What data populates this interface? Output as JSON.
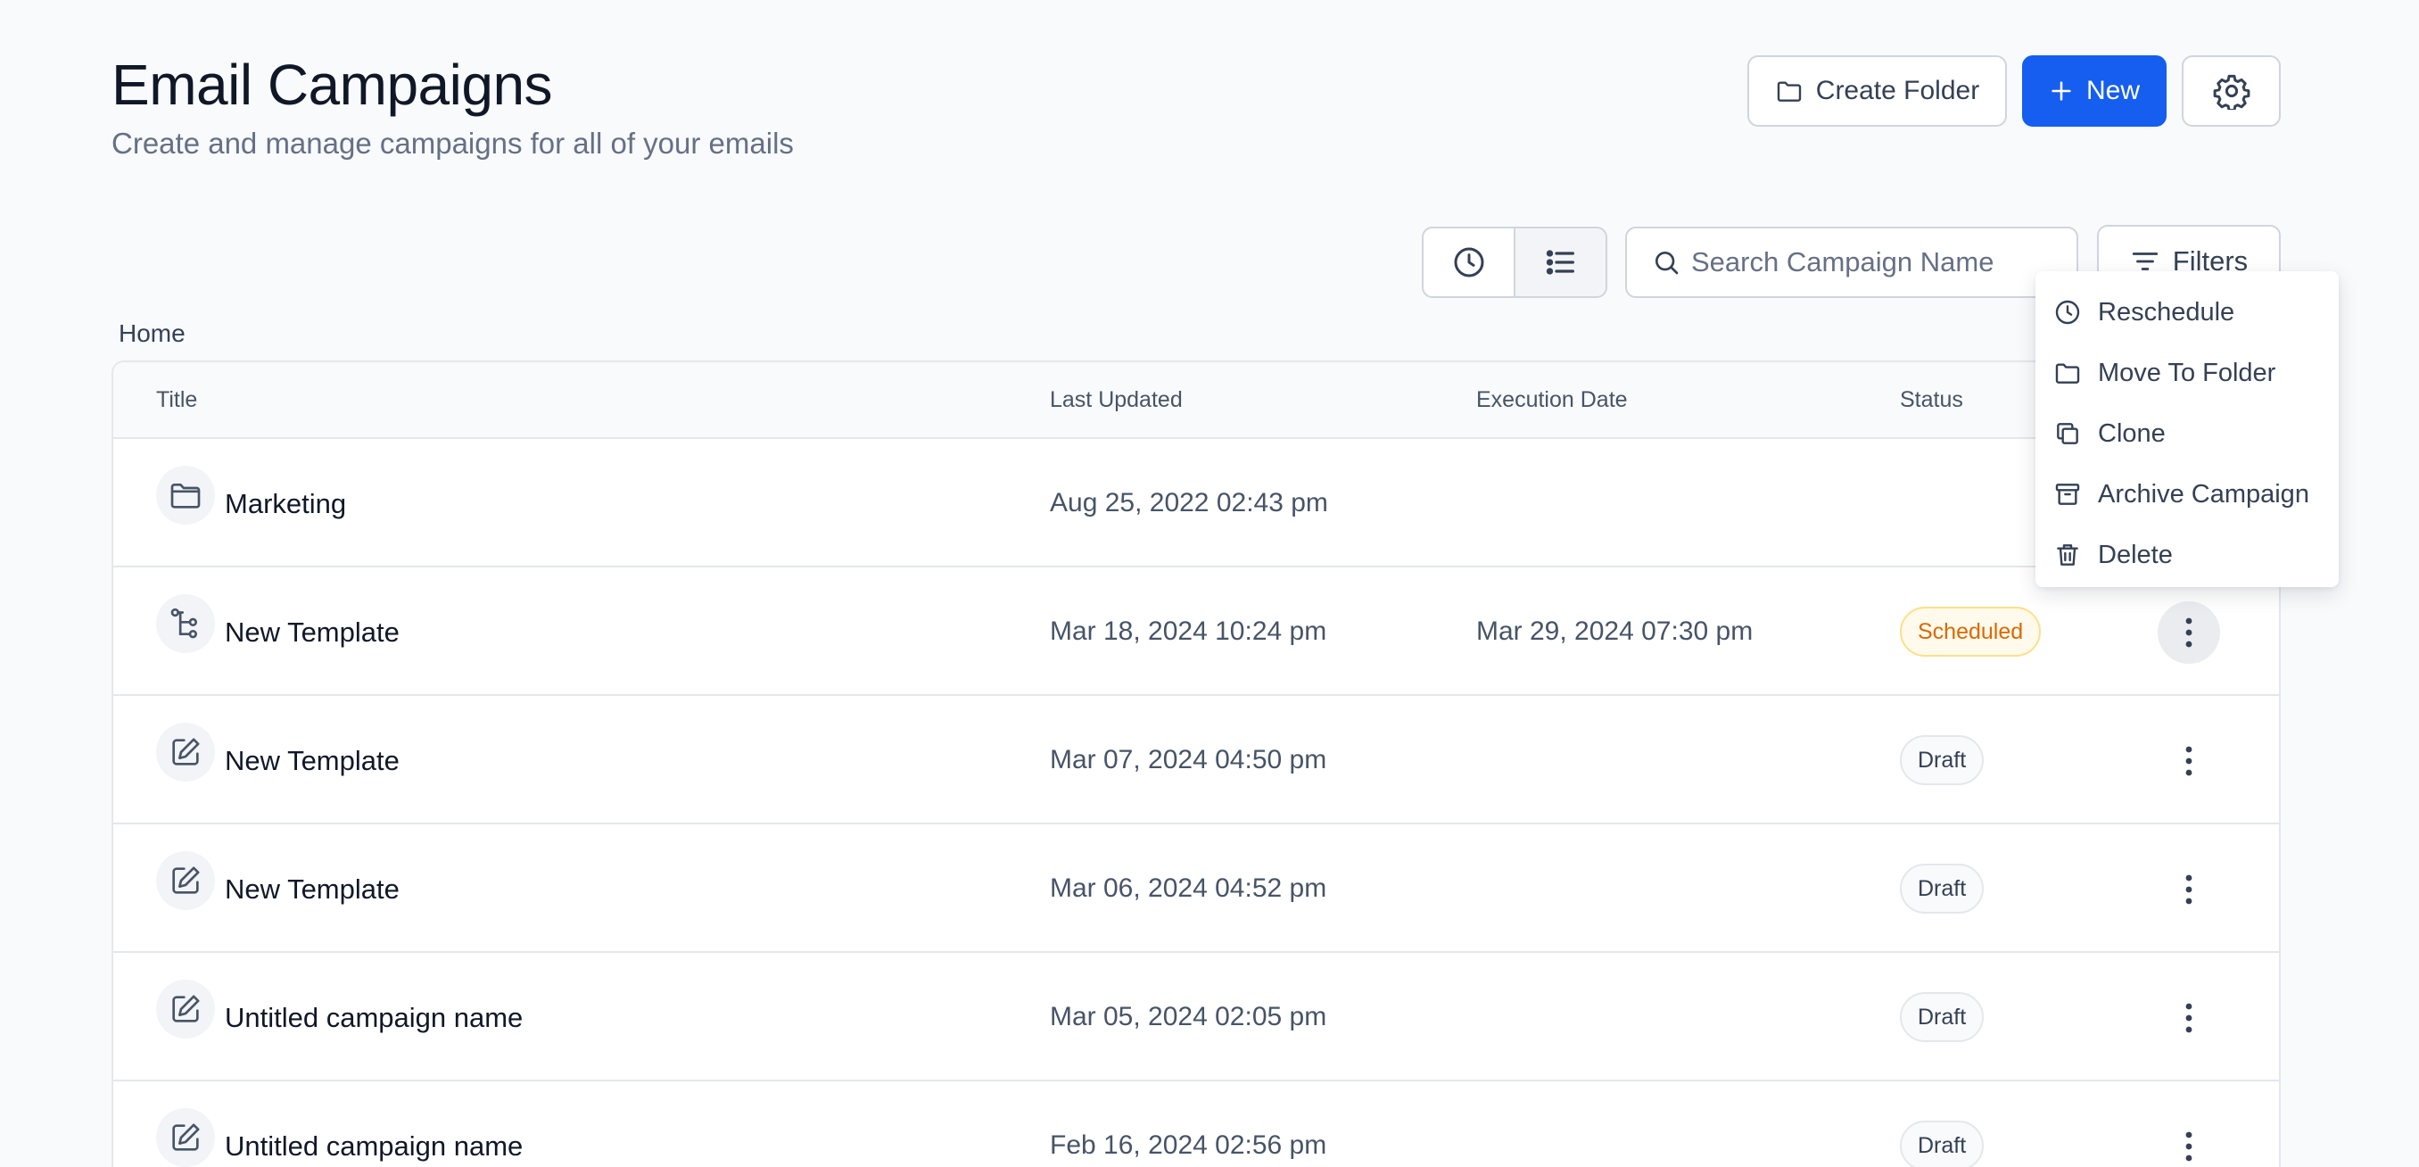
{
  "header": {
    "title": "Email Campaigns",
    "subtitle": "Create and manage campaigns for all of your emails"
  },
  "actions": {
    "create_folder_label": "Create Folder",
    "new_label": "New",
    "settings_icon": "gear-icon"
  },
  "toolbar": {
    "view_icons": [
      "clock-icon",
      "list-icon"
    ],
    "active_view": "list",
    "search_placeholder": "Search Campaign Name",
    "filters_label": "Filters"
  },
  "breadcrumb": "Home",
  "table": {
    "columns": {
      "title": "Title",
      "last_updated": "Last Updated",
      "execution_date": "Execution Date",
      "status": "Status"
    },
    "rows": [
      {
        "icon": "folder-icon",
        "title": "Marketing",
        "last_updated": "Aug 25, 2022 02:43 pm",
        "execution_date": "",
        "status": ""
      },
      {
        "icon": "workflow-icon",
        "title": "New Template",
        "last_updated": "Mar 18, 2024 10:24 pm",
        "execution_date": "Mar 29, 2024 07:30 pm",
        "status": "Scheduled"
      },
      {
        "icon": "edit-icon",
        "title": "New Template",
        "last_updated": "Mar 07, 2024 04:50 pm",
        "execution_date": "",
        "status": "Draft"
      },
      {
        "icon": "edit-icon",
        "title": "New Template",
        "last_updated": "Mar 06, 2024 04:52 pm",
        "execution_date": "",
        "status": "Draft"
      },
      {
        "icon": "edit-icon",
        "title": "Untitled campaign name",
        "last_updated": "Mar 05, 2024 02:05 pm",
        "execution_date": "",
        "status": "Draft"
      },
      {
        "icon": "edit-icon",
        "title": "Untitled campaign name",
        "last_updated": "Feb 16, 2024 02:56 pm",
        "execution_date": "",
        "status": "Draft"
      }
    ]
  },
  "context_menu": {
    "items": [
      {
        "icon": "clock-icon",
        "label": "Reschedule"
      },
      {
        "icon": "folder-icon",
        "label": "Move To Folder"
      },
      {
        "icon": "copy-icon",
        "label": "Clone"
      },
      {
        "icon": "archive-icon",
        "label": "Archive Campaign"
      },
      {
        "icon": "trash-icon",
        "label": "Delete"
      }
    ]
  },
  "colors": {
    "primary": "#155eef",
    "scheduled_bg": "#fffaeb",
    "scheduled_text": "#dc6803",
    "background": "#f8fafc"
  }
}
